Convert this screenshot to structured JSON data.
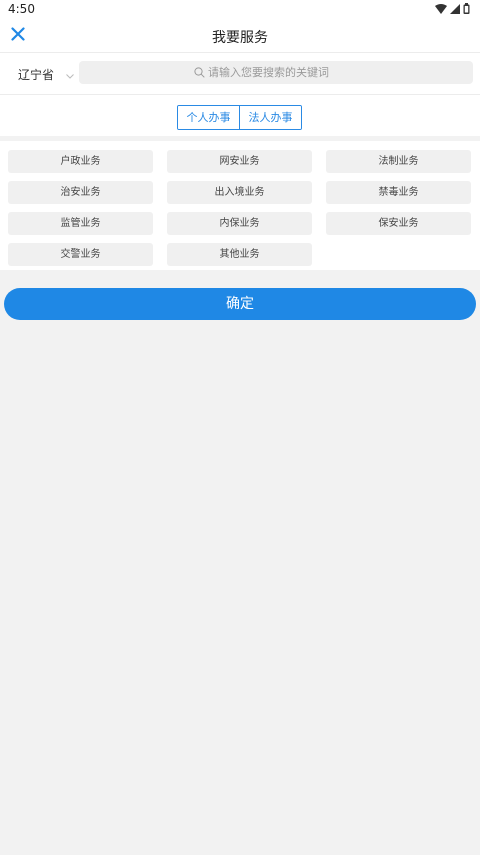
{
  "status_bar": {
    "time": "4:50",
    "icons": [
      "wifi-icon",
      "signal-icon",
      "battery-icon"
    ]
  },
  "header": {
    "title": "我要服务",
    "close_icon": "close-icon"
  },
  "search": {
    "province": "辽宁省",
    "placeholder": "请输入您要搜索的关键词"
  },
  "tabs": [
    {
      "label": "个人办事"
    },
    {
      "label": "法人办事"
    }
  ],
  "categories": [
    "户政业务",
    "网安业务",
    "法制业务",
    "治安业务",
    "出入境业务",
    "禁毒业务",
    "监管业务",
    "内保业务",
    "保安业务",
    "交警业务",
    "其他业务"
  ],
  "confirm_label": "确定",
  "colors": {
    "accent": "#1f88e5",
    "tab_border": "#2a8ae4",
    "background": "#f2f2f2"
  }
}
